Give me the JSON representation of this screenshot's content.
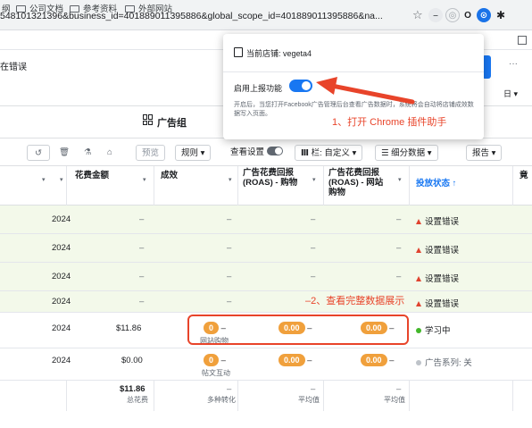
{
  "browser": {
    "url": "548101321396&business_id=401889011395886&global_scope_id=401889011395886&na...",
    "bookmarks": [
      "纲",
      "公司文档",
      "参考资料",
      "外部网站"
    ]
  },
  "page": {
    "error_title": "在错误",
    "adgroup_title": "广告组",
    "more_label": "···",
    "right_label": "日 ▾"
  },
  "popup": {
    "store_label": "当前店铺: vegeta4",
    "enable_label": "启用上报功能",
    "description": "开启后，当您打开Facebook广告管理后台查看广告数据时，系统将会自动将店铺成效数据写入页面。"
  },
  "toolbar": {
    "preview": "预览",
    "rules": "规则 ▾",
    "view_settings": "查看设置",
    "columns": "栏: 自定义 ▾",
    "breakdown": "细分数据 ▾",
    "reports": "报告 ▾"
  },
  "table": {
    "headers": {
      "spend": "花费金额",
      "results": "成效",
      "roas_purchase": "广告花费回报\n(ROAS) - 购物",
      "roas_web": "广告花费回报\n(ROAS) - 网站\n购物",
      "delivery": "投放状态 ↑",
      "extra": "竟"
    },
    "rows": [
      {
        "date": "2024",
        "spend": "–",
        "results": "–",
        "roas1": "–",
        "roas2": "–",
        "status": "设置错误"
      },
      {
        "date": "2024",
        "spend": "–",
        "results": "–",
        "roas1": "–",
        "roas2": "–",
        "status": "设置错误"
      },
      {
        "date": "2024",
        "spend": "–",
        "results": "–",
        "roas1": "–",
        "roas2": "–",
        "status": "设置错误"
      },
      {
        "date": "2024",
        "spend": "–",
        "results": "–",
        "roas1": "–",
        "roas2": "–",
        "status": "设置错误"
      },
      {
        "date": "2024",
        "spend": "$11.86",
        "results_pill": "0",
        "results_dash": "–",
        "results_sub": "网站购物",
        "roas1_pill": "0.00",
        "roas1_dash": "–",
        "roas2_pill": "0.00",
        "roas2_dash": "–",
        "status": "学习中"
      },
      {
        "date": "2024",
        "spend": "$0.00",
        "results_pill": "0",
        "results_dash": "–",
        "results_sub": "帖文互动",
        "roas1_pill": "0.00",
        "roas1_dash": "–",
        "roas2_pill": "0.00",
        "roas2_dash": "–",
        "status": "广告系列: 关"
      }
    ],
    "totals": {
      "spend": "$11.86",
      "spend_sub": "总花费",
      "results": "–",
      "results_sub": "多种转化",
      "roas1": "–",
      "roas1_sub": "平均值",
      "roas2": "–",
      "roas2_sub": "平均值"
    }
  },
  "annotations": {
    "step1": "1、打开 Chrome 插件助手",
    "step2": "–2、查看完整数据展示"
  },
  "colors": {
    "accent": "#1877f2",
    "annotation": "#e8442a",
    "pill": "#f0a03c",
    "row_green": "#f3f9ea"
  }
}
